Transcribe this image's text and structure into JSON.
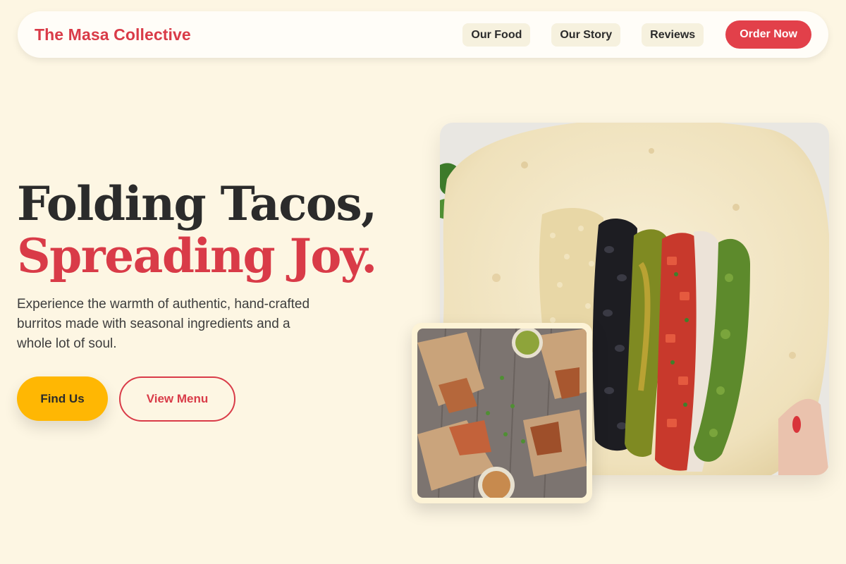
{
  "nav": {
    "brand": "The Masa Collective",
    "links": [
      {
        "label": "Our Food"
      },
      {
        "label": "Our Story"
      },
      {
        "label": "Reviews"
      }
    ],
    "cta": "Order Now"
  },
  "hero": {
    "headline_line1": "Folding Tacos,",
    "headline_line2": "Spreading Joy.",
    "subtitle": "Experience the warmth of authentic, hand-crafted burritos made with seasonal ingredients and a whole lot of soul.",
    "primary_button": "Find Us",
    "secondary_button": "View Menu"
  },
  "images": {
    "main": "burrito-ingredients-photo",
    "secondary": "wrapped-burritos-photo"
  },
  "colors": {
    "background": "#fdf6e3",
    "accent_red": "#d93b48",
    "accent_yellow": "#ffb703",
    "text_dark": "#2b2b2b"
  }
}
